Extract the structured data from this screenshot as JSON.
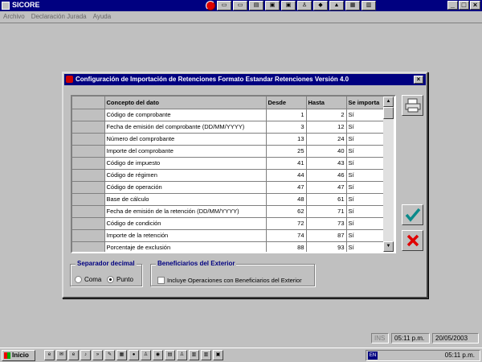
{
  "app": {
    "title": "SICORE",
    "menu": [
      "Archivo",
      "Declaración Jurada",
      "Ayuda"
    ],
    "win_minimize": "_",
    "win_maximize": "□",
    "win_close": "×"
  },
  "status": {
    "ins": "INS",
    "time": "05:11 p.m.",
    "date": "20/05/2003"
  },
  "dialog": {
    "title": "Configuración de Importación de Retenciones Formato Estandar Retenciones Versión 4.0",
    "close": "×",
    "columns": [
      "Concepto del dato",
      "Desde",
      "Hasta",
      "Se importa"
    ],
    "rows": [
      {
        "concepto": "Código de comprobante",
        "desde": "1",
        "hasta": "2",
        "importa": "Sí"
      },
      {
        "concepto": "Fecha de emisión del comprobante  (DD/MM/YYYY)",
        "desde": "3",
        "hasta": "12",
        "importa": "Sí"
      },
      {
        "concepto": "Número del comprobante",
        "desde": "13",
        "hasta": "24",
        "importa": "Sí"
      },
      {
        "concepto": "Importe del comprobante",
        "desde": "25",
        "hasta": "40",
        "importa": "Sí"
      },
      {
        "concepto": "Código de impuesto",
        "desde": "41",
        "hasta": "43",
        "importa": "Sí"
      },
      {
        "concepto": "Código de régimen",
        "desde": "44",
        "hasta": "46",
        "importa": "Sí"
      },
      {
        "concepto": "Código de operación",
        "desde": "47",
        "hasta": "47",
        "importa": "Sí"
      },
      {
        "concepto": "Base de cálculo",
        "desde": "48",
        "hasta": "61",
        "importa": "Sí"
      },
      {
        "concepto": "Fecha de emisión de la retención (DD/MM/YYYY)",
        "desde": "62",
        "hasta": "71",
        "importa": "Sí"
      },
      {
        "concepto": "Código de condición",
        "desde": "72",
        "hasta": "73",
        "importa": "Sí"
      },
      {
        "concepto": "Importe de la retención",
        "desde": "74",
        "hasta": "87",
        "importa": "Sí"
      },
      {
        "concepto": "Porcentaje de exclusión",
        "desde": "88",
        "hasta": "93",
        "importa": "Sí"
      }
    ],
    "separador": {
      "title": "Separador decimal",
      "coma": "Coma",
      "punto": "Punto",
      "selected": "Punto"
    },
    "beneficiarios": {
      "title": "Beneficiarios del Exterior",
      "checkbox": "Incluye Operaciones con Beneficiarios del Exterior",
      "checked": false
    }
  },
  "taskbar": {
    "start": "Inicio",
    "en": "EN",
    "time": "05:11 p.m."
  }
}
